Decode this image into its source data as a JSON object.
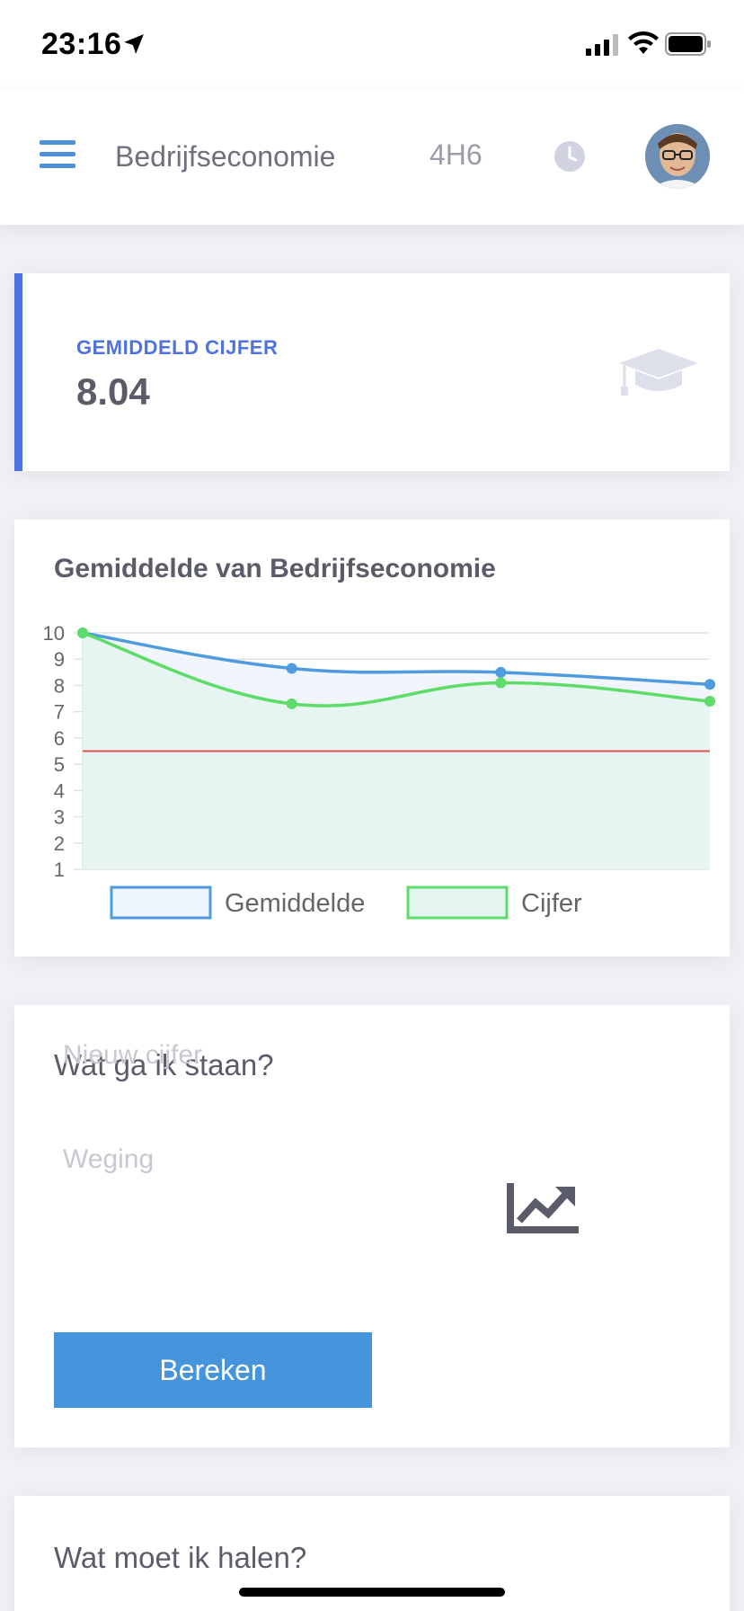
{
  "status_bar": {
    "time": "23:16"
  },
  "header": {
    "subject": "Bedrijfseconomie",
    "class_code": "4H6",
    "icons": [
      "menu-icon",
      "clock-icon",
      "avatar"
    ]
  },
  "average_card": {
    "label": "GEMIDDELD CIJFER",
    "value": "8.04",
    "icon": "graduation-cap-icon"
  },
  "chart_card": {
    "title": "Gemiddelde van Bedrijfseconomie"
  },
  "chart_data": {
    "type": "line",
    "title": "Gemiddelde van Bedrijfseconomie",
    "x": [
      1,
      2,
      3,
      4
    ],
    "ylim": [
      1,
      10
    ],
    "yticks": [
      "10",
      "9",
      "8",
      "7",
      "6",
      "5",
      "4",
      "3",
      "2",
      "1"
    ],
    "grid": true,
    "legend_position": "bottom",
    "series": [
      {
        "name": "Gemiddelde",
        "values": [
          10,
          8.65,
          8.5,
          8.04
        ],
        "color": "#4e9be0",
        "fill": "#eef5fc"
      },
      {
        "name": "Cijfer",
        "values": [
          10,
          7.3,
          8.1,
          7.4
        ],
        "color": "#5ddc6a",
        "fill": "#e4f4ee"
      }
    ],
    "threshold": {
      "value": 5.5,
      "color": "#d9534f"
    }
  },
  "calc_card": {
    "title": "Wat ga ik staan?",
    "new_grade_placeholder": "Nieuw cijfer",
    "weight_placeholder": "Weging",
    "button_label": "Bereken",
    "icon": "chart-trend-icon"
  },
  "need_card": {
    "title": "Wat moet ik halen?"
  }
}
